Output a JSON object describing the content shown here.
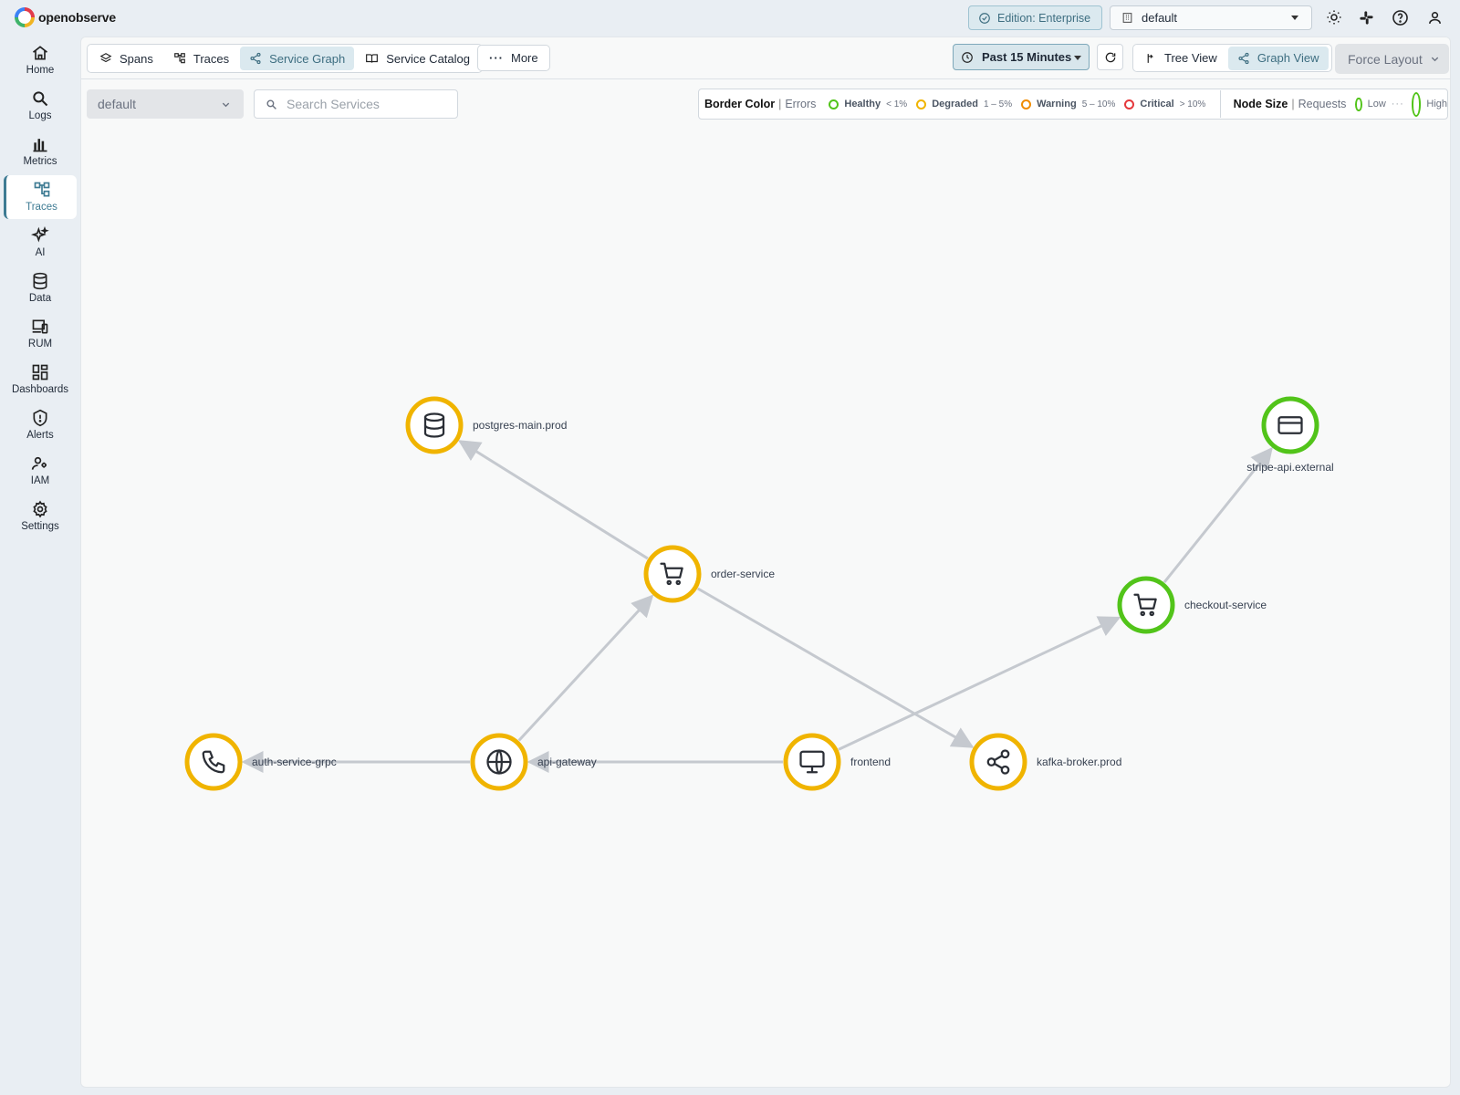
{
  "app": {
    "name": "openobserve"
  },
  "header": {
    "edition_label": "Edition: Enterprise",
    "org_value": "default",
    "icons": [
      "sun-icon",
      "slack-icon",
      "help-icon",
      "user-icon"
    ]
  },
  "sidebar": {
    "items": [
      {
        "label": "Home",
        "icon": "home-icon"
      },
      {
        "label": "Logs",
        "icon": "search-icon"
      },
      {
        "label": "Metrics",
        "icon": "bar-chart-icon"
      },
      {
        "label": "Traces",
        "icon": "traces-icon",
        "active": true
      },
      {
        "label": "AI",
        "icon": "sparkles-icon"
      },
      {
        "label": "Data",
        "icon": "database-icon"
      },
      {
        "label": "RUM",
        "icon": "devices-icon"
      },
      {
        "label": "Dashboards",
        "icon": "dashboard-icon"
      },
      {
        "label": "Alerts",
        "icon": "shield-alert-icon"
      },
      {
        "label": "IAM",
        "icon": "users-icon"
      },
      {
        "label": "Settings",
        "icon": "gear-icon"
      }
    ]
  },
  "toolbar": {
    "tabs": [
      {
        "label": "Spans",
        "icon": "layers-icon"
      },
      {
        "label": "Traces",
        "icon": "traces-icon"
      },
      {
        "label": "Service Graph",
        "icon": "share-icon",
        "active": true
      },
      {
        "label": "Service Catalog",
        "icon": "book-icon"
      }
    ],
    "more_label": "More",
    "time_range": "Past 15 Minutes",
    "views": [
      {
        "label": "Tree View",
        "icon": "tree-icon"
      },
      {
        "label": "Graph View",
        "icon": "share-icon",
        "active": true
      }
    ],
    "layout_label": "Force Layout"
  },
  "filters": {
    "stream_value": "default",
    "search_placeholder": "Search Services"
  },
  "legend": {
    "border_title": "Border Color",
    "border_sub": "Errors",
    "statuses": [
      {
        "name": "Healthy",
        "range": "< 1%",
        "color": "#52c41a"
      },
      {
        "name": "Degraded",
        "range": "1 – 5%",
        "color": "#f0b400"
      },
      {
        "name": "Warning",
        "range": "5 – 10%",
        "color": "#f08c00"
      },
      {
        "name": "Critical",
        "range": "> 10%",
        "color": "#e5383b"
      }
    ],
    "size_title": "Node Size",
    "size_sub": "Requests",
    "size_low": "Low",
    "size_high": "High"
  },
  "graph": {
    "nodes": [
      {
        "id": "postgres-main.prod",
        "icon": "database-icon",
        "status": "Degraded"
      },
      {
        "id": "stripe-api.external",
        "icon": "credit-card-icon",
        "status": "Healthy"
      },
      {
        "id": "order-service",
        "icon": "cart-icon",
        "status": "Degraded"
      },
      {
        "id": "checkout-service",
        "icon": "cart-icon",
        "status": "Healthy"
      },
      {
        "id": "auth-service-grpc",
        "icon": "phone-icon",
        "status": "Degraded"
      },
      {
        "id": "api-gateway",
        "icon": "globe-icon",
        "status": "Degraded"
      },
      {
        "id": "frontend",
        "icon": "monitor-icon",
        "status": "Degraded"
      },
      {
        "id": "kafka-broker.prod",
        "icon": "share-icon",
        "status": "Degraded"
      }
    ],
    "edges": [
      {
        "from": "order-service",
        "to": "postgres-main.prod"
      },
      {
        "from": "checkout-service",
        "to": "stripe-api.external"
      },
      {
        "from": "api-gateway",
        "to": "order-service"
      },
      {
        "from": "order-service",
        "to": "kafka-broker.prod"
      },
      {
        "from": "frontend",
        "to": "checkout-service"
      },
      {
        "from": "api-gateway",
        "to": "auth-service-grpc"
      },
      {
        "from": "frontend",
        "to": "api-gateway"
      }
    ]
  }
}
